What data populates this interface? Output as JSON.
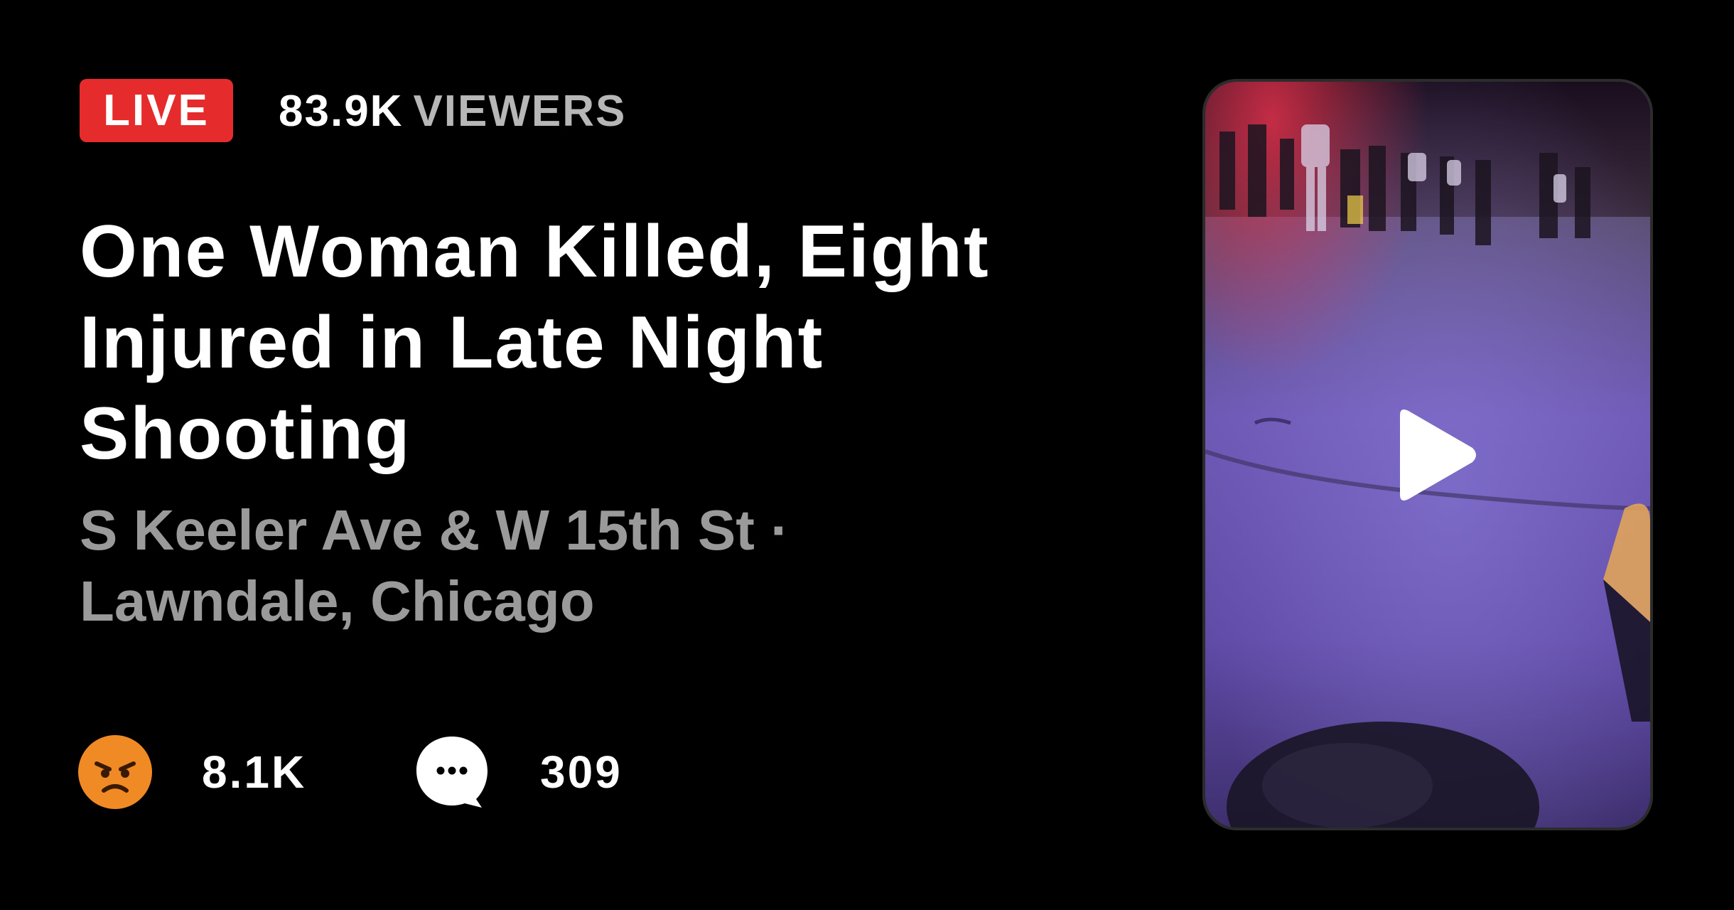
{
  "header": {
    "live_label": "LIVE",
    "viewer_count": "83.9K",
    "viewer_unit": "VIEWERS"
  },
  "article": {
    "title": "One Woman Killed, Eight Injured in Late Night Shooting",
    "location": "S Keeler Ave & W 15th St · Lawndale, Chicago"
  },
  "stats": {
    "reactions": {
      "icon": "angry-face-icon",
      "count": "8.1K",
      "color": "#f08a24"
    },
    "comments": {
      "icon": "speech-bubble-icon",
      "count": "309"
    }
  },
  "video": {
    "icon": "play-icon"
  },
  "colors": {
    "background": "#000000",
    "live_red": "#e52b2b",
    "muted_text": "#9a9a9a",
    "viewer_unit": "#b7b7b7"
  }
}
